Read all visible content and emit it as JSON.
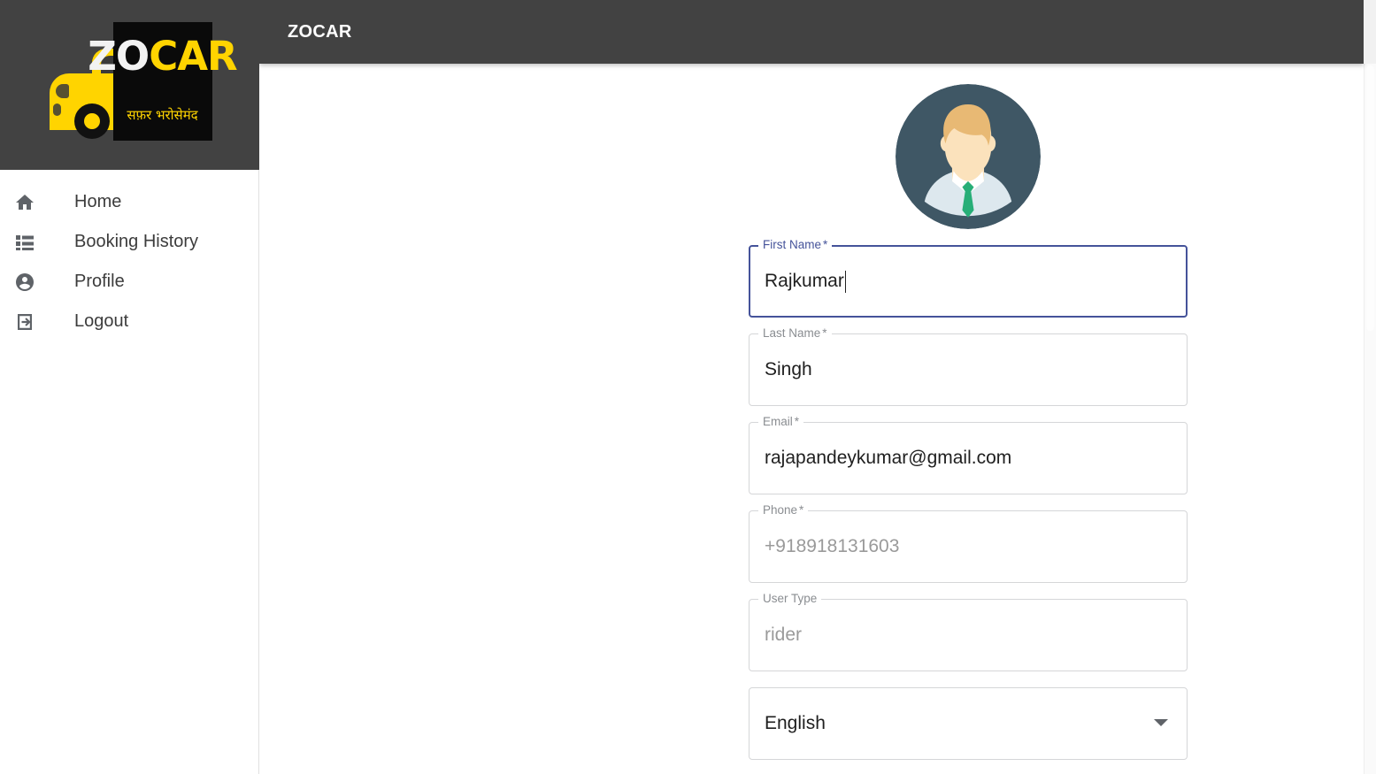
{
  "app": {
    "brand": "ZOCAR",
    "logo": {
      "word_part1": "ZO",
      "word_part2": "CAR",
      "tagline": "सफ़र भरोसेमंद",
      "car_color": "#FFD400",
      "box_color": "#0a0a0a",
      "sidebar_header_bg": "#424242"
    }
  },
  "header": {
    "title": "ZOCAR",
    "background": "#424242",
    "text_color": "#ffffff"
  },
  "sidebar": {
    "items": [
      {
        "label": "Home",
        "icon": "home-icon"
      },
      {
        "label": "Booking History",
        "icon": "list-icon"
      },
      {
        "label": "Profile",
        "icon": "account-circle-icon"
      },
      {
        "label": "Logout",
        "icon": "logout-icon"
      }
    ]
  },
  "profile": {
    "avatar_icon": "user-avatar-illustration",
    "avatar_colors": {
      "circle": "#3F5765",
      "hair": "#E8B974",
      "skin": "#FBE2BC",
      "shirt": "#DDE8EE",
      "tie": "#27AE77"
    },
    "focus_color": "#45539a",
    "fields": [
      {
        "name": "first-name",
        "label": "First Name",
        "required": true,
        "value": "Rajkumar",
        "focused": true,
        "disabled": false
      },
      {
        "name": "last-name",
        "label": "Last Name",
        "required": true,
        "value": "Singh",
        "focused": false,
        "disabled": false
      },
      {
        "name": "email",
        "label": "Email",
        "required": true,
        "value": "rajapandeykumar@gmail.com",
        "focused": false,
        "disabled": false
      },
      {
        "name": "phone",
        "label": "Phone",
        "required": true,
        "value": "+918918131603",
        "focused": false,
        "disabled": true
      },
      {
        "name": "user-type",
        "label": "User Type",
        "required": false,
        "value": "rider",
        "focused": false,
        "disabled": true
      }
    ],
    "language_select": {
      "name": "language",
      "selected": "English",
      "arrow_icon": "chevron-down-icon"
    }
  }
}
